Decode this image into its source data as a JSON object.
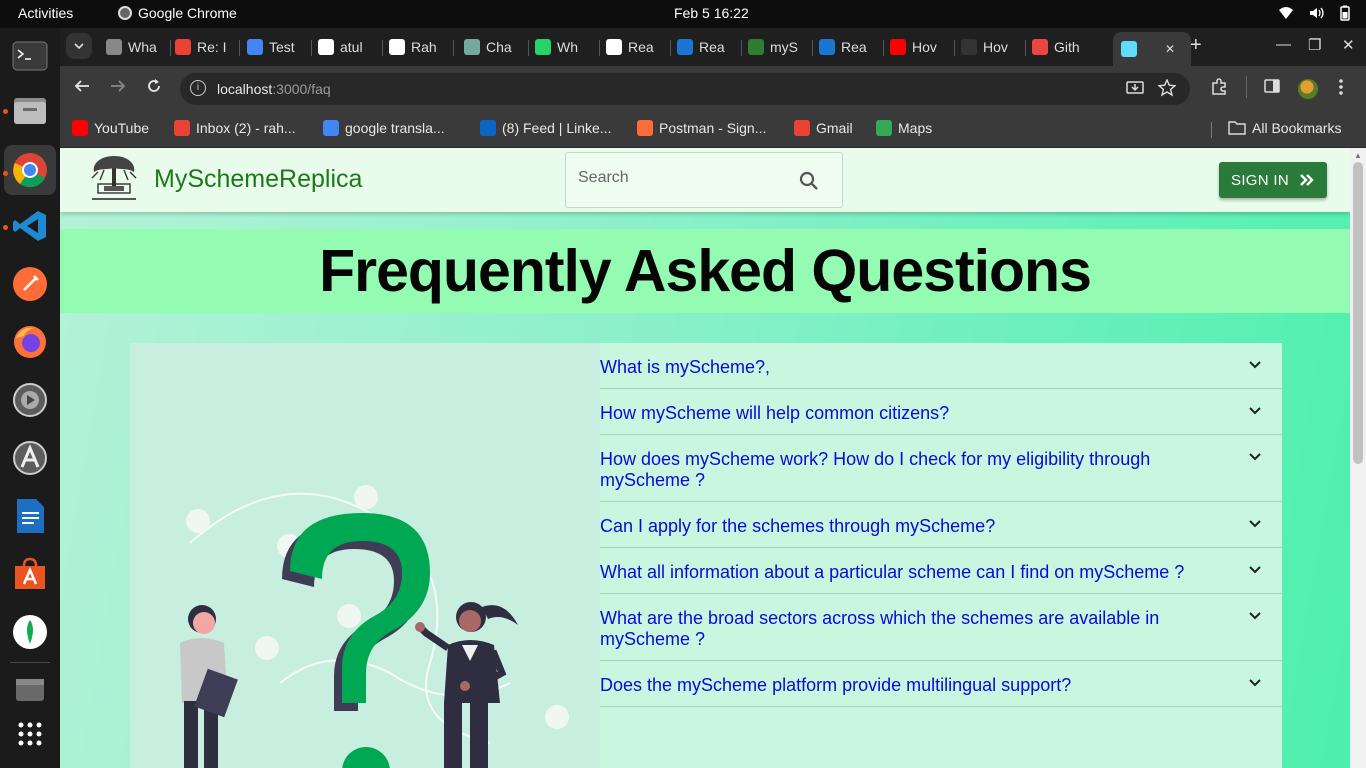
{
  "system": {
    "activities": "Activities",
    "app_name": "Google Chrome",
    "clock": "Feb 5  16:22"
  },
  "tabs": [
    {
      "label": "Wha",
      "icon": "chrome-icon",
      "color": "#888888"
    },
    {
      "label": "Re: I",
      "icon": "gmail-icon",
      "color": "#ea4335"
    },
    {
      "label": "Test",
      "icon": "docs-icon",
      "color": "#4285f4"
    },
    {
      "label": "atul",
      "icon": "github-icon",
      "color": "#ffffff"
    },
    {
      "label": "Rah",
      "icon": "github-icon",
      "color": "#ffffff"
    },
    {
      "label": "Cha",
      "icon": "chatgpt-icon",
      "color": "#74aa9c"
    },
    {
      "label": "Wh",
      "icon": "whatsapp-icon",
      "color": "#25d366"
    },
    {
      "label": "Rea",
      "icon": "fs-icon",
      "color": "#ffffff"
    },
    {
      "label": "Rea",
      "icon": "mui-icon",
      "color": "#1976d2"
    },
    {
      "label": "myS",
      "icon": "myscheme-icon",
      "color": "#2e7d32"
    },
    {
      "label": "Rea",
      "icon": "mui-icon",
      "color": "#1976d2"
    },
    {
      "label": "Hov",
      "icon": "youtube-icon",
      "color": "#ff0000"
    },
    {
      "label": "Hov",
      "icon": "em-icon",
      "color": "#333333"
    },
    {
      "label": "Gith",
      "icon": "git-icon",
      "color": "#e44"
    },
    {
      "label": "",
      "icon": "react-icon",
      "color": "#61dafb"
    }
  ],
  "toolbar": {
    "url_host": "localhost",
    "url_path": ":3000/faq"
  },
  "bookmarks": [
    {
      "label": "YouTube",
      "icon": "youtube-icon",
      "color": "#ff0000"
    },
    {
      "label": "Inbox (2) - rah...",
      "icon": "gmail-icon",
      "color": "#ea4335"
    },
    {
      "label": "google transla...",
      "icon": "google-icon",
      "color": "#4285f4"
    },
    {
      "label": "(8) Feed | Linke...",
      "icon": "linkedin-icon",
      "color": "#0a66c2"
    },
    {
      "label": "Postman - Sign...",
      "icon": "postman-icon",
      "color": "#ff6c37"
    },
    {
      "label": "Gmail",
      "icon": "gmail-icon",
      "color": "#ea4335"
    },
    {
      "label": "Maps",
      "icon": "maps-icon",
      "color": "#34a853"
    }
  ],
  "all_bookmarks": "All Bookmarks",
  "site": {
    "brand": "MySchemeReplica",
    "search_placeholder": "Search",
    "signin_label": "SIGN IN",
    "page_title": "Frequently Asked Questions",
    "faqs": [
      "What is myScheme?,",
      "How myScheme will help common citizens?",
      "How does myScheme work? How do I check for my eligibility through myScheme ?",
      "Can I apply for the schemes through myScheme?",
      "What all information about a particular scheme can I find on myScheme ?",
      "What are the broad sectors across which the schemes are available in myScheme ?",
      "Does the myScheme platform provide multilingual support?"
    ]
  },
  "colors": {
    "accent_green": "#2a7a3a",
    "faq_link": "#0a0ad8",
    "title_band": "#94fbb2"
  }
}
